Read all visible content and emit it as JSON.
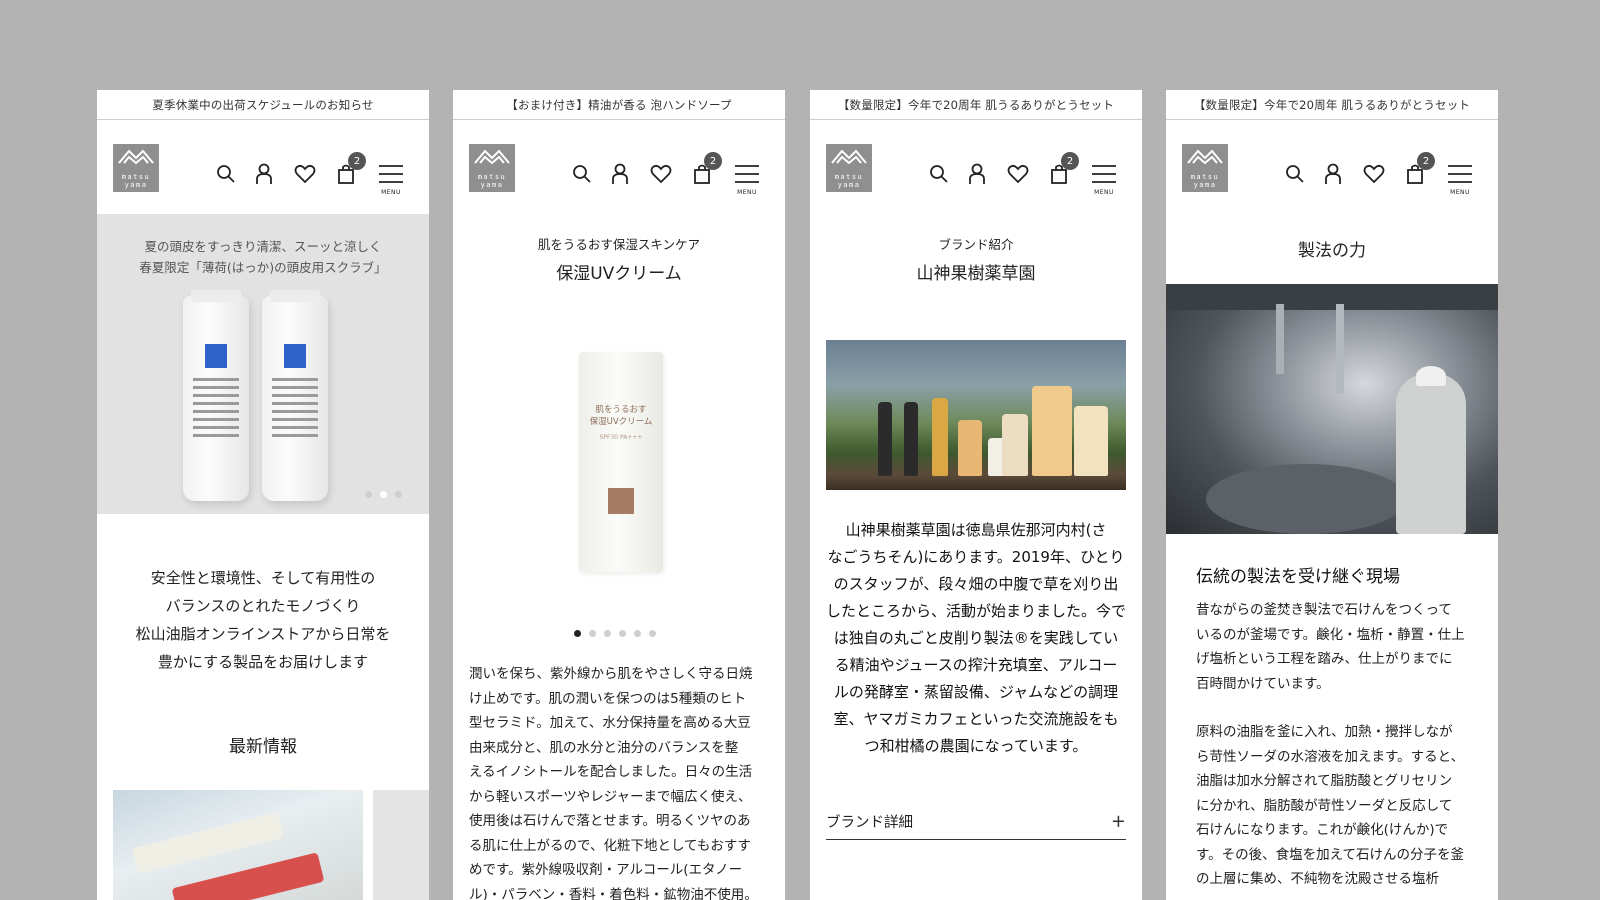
{
  "common": {
    "logo_line1": "matsu",
    "logo_line2": "yama",
    "cart_count": "2",
    "menu_label": "MENU"
  },
  "screen1": {
    "announcement": "夏季休業中の出荷スケジュールのお知らせ",
    "hero_caption_1": "夏の頭皮をすっきり清潔、スーッと涼しく",
    "hero_caption_2": "春夏限定「薄荷(はっか)の頭皮用スクラブ」",
    "tagline": [
      "安全性と環境性、そして有用性の",
      "バランスのとれたモノづくり",
      "松山油脂オンラインストアから日常を",
      "豊かにする製品をお届けします"
    ],
    "section_title": "最新情報",
    "carousel_active_index": 1,
    "carousel_count": 3
  },
  "screen2": {
    "announcement": "【おまけ付き】精油が香る 泡ハンドソープ",
    "subtitle": "肌をうるおす保湿スキンケア",
    "title": "保湿UVクリーム",
    "product_label_1": "肌をうるおす",
    "product_label_2": "保湿UVクリーム",
    "product_label_3": "SPF30 PA+++",
    "carousel_active_index": 0,
    "carousel_count": 6,
    "description": [
      "潤いを保ち、紫外線から肌をやさしく守る日焼",
      "け止めです。肌の潤いを保つのは5種類のヒト",
      "型セラミド。加えて、水分保持量を高める大豆",
      "由来成分と、肌の水分と油分のバランスを整",
      "えるイノシトールを配合しました。日々の生活",
      "から軽いスポーツやレジャーまで幅広く使え、",
      "使用後は石けんで落とせます。明るくツヤのあ",
      "る肌に仕上がるので、化粧下地としてもおすす",
      "めです。紫外線吸収剤・アルコール(エタノー",
      "ル)・パラベン・香料・着色料・鉱物油不使用。"
    ]
  },
  "screen3": {
    "announcement": "【数量限定】今年で20周年 肌うるありがとうセット",
    "subtitle": "ブランド紹介",
    "title": "山神果樹薬草園",
    "description": [
      "山神果樹薬草園は徳島県佐那河内村(さ",
      "なごうちそん)にあります。2019年、ひとり",
      "のスタッフが、段々畑の中腹で草を刈り出",
      "したところから、活動が始まりました。今で",
      "は独自の丸ごと皮削り製法®を実践してい",
      "る精油やジュースの搾汁充填室、アルコー",
      "ルの発酵室・蒸留設備、ジャムなどの調理",
      "室、ヤマガミカフェといった交流施設をも",
      "つ和柑橘の農園になっています。"
    ],
    "accordion_label": "ブランド詳細",
    "accordion_icon": "+"
  },
  "screen4": {
    "announcement": "【数量限定】今年で20周年 肌うるありがとうセット",
    "title": "製法の力",
    "heading": "伝統の製法を受け継ぐ現場",
    "para1": [
      "昔ながらの釜焚き製法で石けんをつくって",
      "いるのが釜場です。鹸化・塩析・静置・仕上",
      "げ塩析という工程を踏み、仕上がりまでに",
      "百時間かけています。"
    ],
    "para2": [
      "原料の油脂を釜に入れ、加熱・攪拌しなが",
      "ら苛性ソーダの水溶液を加えます。すると、",
      "油脂は加水分解されて脂肪酸とグリセリン",
      "に分かれ、脂肪酸が苛性ソーダと反応して",
      "石けんになります。これが鹸化(けんか)で",
      "す。その後、食塩を加えて石けんの分子を釜",
      "の上層に集め、不純物を沈殿させる塩析"
    ]
  },
  "icons": [
    "search-icon",
    "account-icon",
    "heart-icon",
    "cart-icon",
    "hamburger-icon"
  ]
}
